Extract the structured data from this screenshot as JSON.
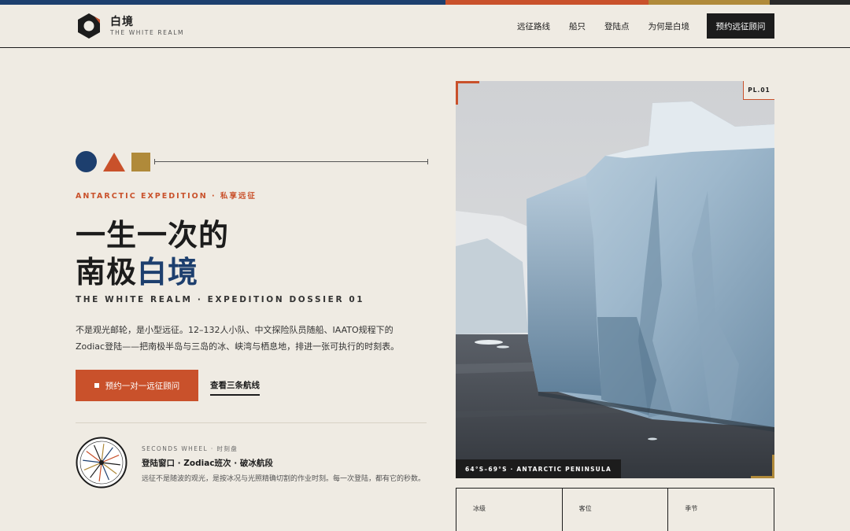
{
  "colors": {
    "navy": "#1d3f6e",
    "rust": "#c9512b",
    "gold": "#b08a3a",
    "ink": "#1c1c1c",
    "paper": "#efebe3"
  },
  "brand": {
    "name": "白境",
    "tagline": "THE WHITE REALM",
    "icon": "hexagon-logo-icon"
  },
  "nav": {
    "items": [
      "远征路线",
      "船只",
      "登陆点",
      "为何是白境"
    ],
    "cta": "预约远征顾问"
  },
  "hero": {
    "eyebrow": "ANTARCTIC EXPEDITION · 私享远征",
    "title_line1": "一生一次的",
    "title_line2_a": "南极",
    "title_line2_b": "白境",
    "subtitle": "THE WHITE REALM · EXPEDITION DOSSIER 01",
    "desc_line1": "不是观光邮轮，是小型远征。12–132人小队、中文探险队员随船、IAATO规程下的",
    "desc_line2": "Zodiac登陆——把南极半岛与三岛的冰、峡湾与栖息地，排进一张可执行的时刻表。",
    "primary_button": "预约一对一远征顾问",
    "secondary_link": "查看三条航线"
  },
  "wheel": {
    "small": "SECONDS WHEEL · 时刻盘",
    "title": "登陆窗口 · Zodiac班次 · 破冰航段",
    "desc": "远征不是随波的观光，是按冰况与光照精确切割的作业时刻。每一次登陆，都有它的秒数。"
  },
  "photo": {
    "plate": "PL.01",
    "coord": "64°S–69°S · ANTARCTIC PENINSULA"
  },
  "cards": [
    "冰级",
    "客位",
    "季节"
  ]
}
